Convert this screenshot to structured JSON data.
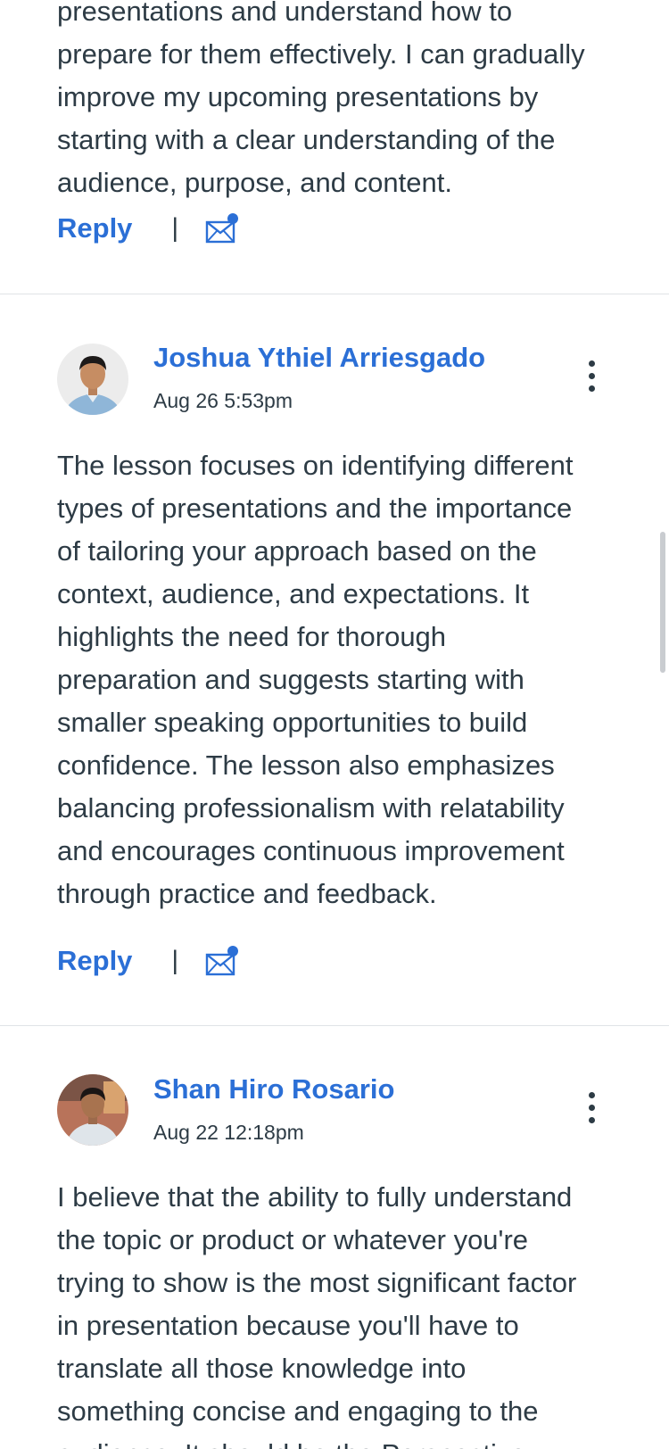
{
  "entries": [
    {
      "body": "presentations and understand how to\nprepare for them effectively. I can gradually\nimprove my upcoming presentations by\nstarting with a clear understanding of the\naudience, purpose, and content.",
      "reply_label": "Reply",
      "separator": "|"
    },
    {
      "author": "Joshua Ythiel Arriesgado",
      "timestamp": "Aug 26 5:53pm",
      "body": "The lesson focuses on identifying different\ntypes of presentations and the importance\nof tailoring your approach based on the\ncontext, audience, and expectations. It\nhighlights the need for thorough\npreparation and suggests starting with\nsmaller speaking opportunities to build\nconfidence. The lesson also emphasizes\nbalancing professionalism with relatability\nand encourages continuous improvement\nthrough practice and feedback.",
      "reply_label": "Reply",
      "separator": "|"
    },
    {
      "author": "Shan Hiro Rosario",
      "timestamp": "Aug 22 12:18pm",
      "body": "I believe that the ability to fully understand\nthe topic or product or whatever you're\ntrying to show is the most significant factor\nin presentation because you'll have to\ntranslate all those knowledge into\nsomething concise and engaging to the\naudience. It should be the Perspective"
    }
  ],
  "icons": {
    "mail": "mail-unread-icon",
    "more": "more-options-icon"
  },
  "colors": {
    "link": "#2b6fd6",
    "text": "#2d3b45",
    "divider": "#e0e3e6"
  }
}
